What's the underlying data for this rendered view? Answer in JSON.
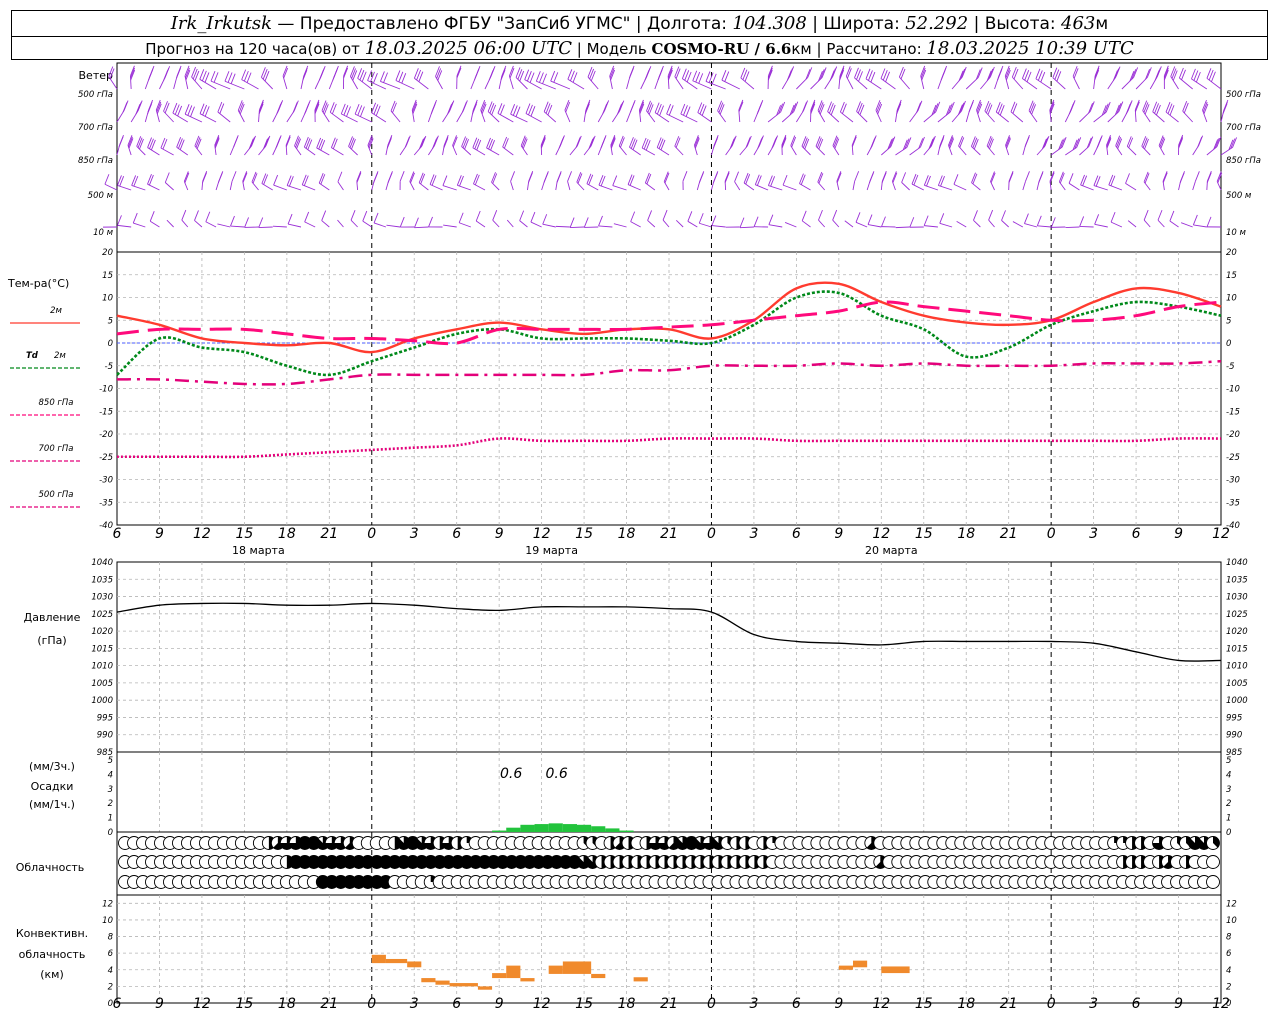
{
  "header": {
    "station": "Irk_Irkutsk",
    "provider": " — Предоставлено ФГБУ \"ЗапСиб УГМС\" | Долгота: ",
    "lon": "104.308",
    "lat_label": " | Широта: ",
    "lat": "52.292",
    "alt_label": " | Высота: ",
    "alt": "463",
    "alt_unit": "м",
    "forecast_prefix": "Прогноз на 120 часа(ов) от ",
    "start_time": "18.03.2025 06:00 UTC",
    "model_label": " | Модель ",
    "model": "COSMO-RU / 6.6",
    "model_unit": "км",
    "calc_label": " | Рассчитано: ",
    "calc_time": "18.03.2025 10:39 UTC"
  },
  "colors": {
    "wind": "#9a2fd6",
    "t2m": "#ff3b2f",
    "td2m": "#00891a",
    "t850": "#ff0a7c",
    "t700": "#e3007a",
    "t500": "#e3007a",
    "pressure": "#000000",
    "precip": "#22c33c",
    "convective": "#f08a2c",
    "zero_line": "#4a5bff",
    "grid": "#b5b5b5"
  },
  "wind_panel": {
    "title": "Ветер",
    "levels": [
      "500 гПа",
      "700 гПа",
      "850 гПа",
      "500 м",
      "10 м"
    ],
    "icon": "wind-barb-icon"
  },
  "temp_panel": {
    "title": "Тем-ра(°С)",
    "legend": [
      {
        "id": "t2m",
        "label": "2м"
      },
      {
        "id": "td2m",
        "label_sym": "Td",
        "label": "2м"
      },
      {
        "id": "t850",
        "label": "850 гПа"
      },
      {
        "id": "t700",
        "label": "700 гПа"
      },
      {
        "id": "t500",
        "label": "500 гПа"
      }
    ]
  },
  "pressure_panel": {
    "title1": "Давление",
    "title2": "(гПа)"
  },
  "precip_panel": {
    "unit1": "(мм/3ч.)",
    "title": "Осадки",
    "unit2": "(мм/1ч.)",
    "labels": [
      "0.6",
      "0.6"
    ]
  },
  "cloud_panel": {
    "title": "Облачность",
    "icon": "cloud-cover-circle-icon"
  },
  "conv_panel": {
    "title1": "Конвективн.",
    "title2": "облачность",
    "title3": "(км)"
  },
  "x_axis": {
    "ticks": [
      "6",
      "9",
      "12",
      "15",
      "18",
      "21",
      "0",
      "3",
      "6",
      "9",
      "12",
      "15",
      "18",
      "21",
      "0",
      "3",
      "6",
      "9",
      "12",
      "15",
      "18",
      "21",
      "0",
      "3",
      "6",
      "9",
      "12"
    ],
    "days": [
      "18 марта",
      "19 марта",
      "20 марта"
    ]
  },
  "chart_data": {
    "type": "line",
    "x_hours": [
      0,
      3,
      6,
      9,
      12,
      15,
      18,
      21,
      24,
      27,
      30,
      33,
      36,
      39,
      42,
      45,
      48,
      51,
      54,
      57,
      60,
      63,
      66,
      69,
      72,
      75,
      78
    ],
    "temperature": {
      "ylim": [
        -40,
        20
      ],
      "yticks": [
        "20",
        "15",
        "10",
        "5",
        "0",
        "-5",
        "-10",
        "-15",
        "-20",
        "-25",
        "-30",
        "-35",
        "-40"
      ],
      "series": [
        {
          "id": "t2m",
          "style": "solid",
          "values": [
            6,
            4,
            1,
            0,
            -0.5,
            0,
            -2,
            1,
            3,
            4.5,
            3,
            2,
            3,
            3,
            1,
            5,
            12,
            13,
            9,
            6,
            4.5,
            4,
            5,
            9,
            12,
            11,
            8
          ]
        },
        {
          "id": "td2m",
          "style": "dotted",
          "values": [
            -7,
            1,
            -1,
            -2,
            -5,
            -7,
            -4,
            -1,
            2,
            3,
            1,
            1,
            1,
            0.5,
            0,
            4,
            10,
            11,
            6,
            3,
            -3,
            -1,
            4,
            7,
            9,
            8,
            6
          ]
        },
        {
          "id": "t850",
          "style": "longdash",
          "values": [
            2,
            3,
            3,
            3,
            2,
            1,
            1,
            0.5,
            0,
            3,
            3,
            3,
            3,
            3.5,
            4,
            5,
            6,
            7,
            9,
            8,
            7,
            6,
            5,
            5,
            6,
            8,
            9
          ]
        },
        {
          "id": "t700",
          "style": "dashdot",
          "values": [
            -8,
            -8,
            -8.5,
            -9,
            -9,
            -8,
            -7,
            -7,
            -7,
            -7,
            -7,
            -7,
            -6,
            -6,
            -5,
            -5,
            -5,
            -4.5,
            -5,
            -4.5,
            -5,
            -5,
            -5,
            -4.5,
            -4.5,
            -4.5,
            -4
          ]
        },
        {
          "id": "t500",
          "style": "dotted",
          "values": [
            -25,
            -25,
            -25,
            -25,
            -24.5,
            -24,
            -23.5,
            -23,
            -22.5,
            -21,
            -21.5,
            -21.5,
            -21.5,
            -21,
            -21,
            -21,
            -21.5,
            -21.5,
            -21.5,
            -21.5,
            -21.5,
            -21.5,
            -21.5,
            -21.5,
            -21.5,
            -21,
            -21
          ]
        }
      ]
    },
    "pressure": {
      "ylim": [
        985,
        1040
      ],
      "yticks": [
        "1040",
        "1035",
        "1030",
        "1025",
        "1020",
        "1015",
        "1010",
        "1005",
        "1000",
        "995",
        "990",
        "985"
      ],
      "values": [
        1025.5,
        1027.5,
        1028,
        1028,
        1027.5,
        1027.5,
        1028,
        1027.5,
        1026.5,
        1026,
        1027,
        1027,
        1027,
        1026.5,
        1025.5,
        1019,
        1017,
        1016.5,
        1016,
        1017,
        1017,
        1017,
        1017,
        1016.5,
        1014,
        1011.5,
        1011.5
      ]
    },
    "precipitation": {
      "ylim": [
        0,
        5
      ],
      "yticks": [
        "5",
        "4",
        "3",
        "2",
        "1",
        "0"
      ],
      "x_hours": [
        27,
        28,
        29,
        30,
        31,
        32,
        33,
        34,
        35,
        36
      ],
      "values": [
        0.1,
        0.3,
        0.5,
        0.55,
        0.6,
        0.55,
        0.5,
        0.4,
        0.25,
        0.1
      ]
    },
    "cloud_rows": [
      [
        "0",
        "0",
        "0",
        "0",
        "0",
        "0",
        "0",
        "0",
        "0",
        "0",
        "0",
        "0",
        "0",
        "0",
        "0",
        "0",
        "4",
        "5",
        "6",
        "6",
        "8",
        "8",
        "7",
        "6",
        "6",
        "5",
        "0",
        "0",
        "0",
        "0",
        "4",
        "7",
        "8",
        "7",
        "6",
        "4",
        "6",
        "4",
        "2",
        "0",
        "0",
        "0",
        "0",
        "0",
        "0",
        "0",
        "0",
        "0",
        "0",
        "0",
        "0",
        "3",
        "3",
        "0",
        "4",
        "5",
        "4",
        "0",
        "4",
        "6",
        "6",
        "5",
        "7",
        "8",
        "7",
        "6",
        "7",
        "3",
        "4",
        "4",
        "0",
        "4",
        "2",
        "0",
        "0",
        "0",
        "0",
        "0",
        "0",
        "0",
        "0",
        "0",
        "0",
        "5",
        "0",
        "0",
        "0",
        "0",
        "0",
        "0",
        "0",
        "0",
        "0",
        "0",
        "0",
        "0",
        "0",
        "0",
        "0",
        "0",
        "0",
        "0",
        "0",
        "0",
        "0",
        "0",
        "0",
        "0",
        "0",
        "0",
        "2",
        "2",
        "4",
        "4",
        "0",
        "6",
        "0",
        "3",
        "3",
        "7",
        "7",
        "3"
      ],
      [
        "0",
        "0",
        "0",
        "0",
        "0",
        "0",
        "0",
        "0",
        "0",
        "0",
        "0",
        "0",
        "0",
        "0",
        "0",
        "0",
        "0",
        "0",
        "4",
        "8",
        "8",
        "8",
        "8",
        "8",
        "8",
        "8",
        "8",
        "8",
        "8",
        "8",
        "8",
        "8",
        "8",
        "8",
        "8",
        "8",
        "8",
        "8",
        "8",
        "8",
        "8",
        "8",
        "8",
        "8",
        "8",
        "8",
        "8",
        "8",
        "8",
        "8",
        "8",
        "7",
        "7",
        "4",
        "4",
        "4",
        "4",
        "4",
        "4",
        "4",
        "4",
        "4",
        "4",
        "4",
        "4",
        "4",
        "4",
        "4",
        "4",
        "4",
        "4",
        "4",
        "0",
        "0",
        "0",
        "0",
        "0",
        "0",
        "0",
        "0",
        "0",
        "0",
        "0",
        "0",
        "5",
        "0",
        "0",
        "0",
        "0",
        "0",
        "0",
        "0",
        "0",
        "0",
        "0",
        "0",
        "0",
        "0",
        "0",
        "0",
        "0",
        "0",
        "0",
        "0",
        "0",
        "0",
        "0",
        "0",
        "0",
        "0",
        "0",
        "4",
        "4",
        "4",
        "0",
        "4",
        "5",
        "0",
        "4",
        "0",
        "0",
        "0"
      ],
      [
        "0",
        "0",
        "0",
        "0",
        "0",
        "0",
        "0",
        "0",
        "0",
        "0",
        "0",
        "0",
        "0",
        "0",
        "0",
        "0",
        "0",
        "0",
        "0",
        "0",
        "0",
        "0",
        "8",
        "8",
        "8",
        "8",
        "8",
        "8",
        "8",
        "8",
        "0",
        "0",
        "0",
        "0",
        "2",
        "0",
        "0",
        "0",
        "0",
        "0",
        "0",
        "0",
        "0",
        "0",
        "0",
        "0",
        "0",
        "0",
        "0",
        "0",
        "0",
        "0",
        "0",
        "0",
        "0",
        "0",
        "0",
        "0",
        "0",
        "0",
        "0",
        "0",
        "0",
        "0",
        "0",
        "0",
        "0",
        "0",
        "0",
        "0",
        "0",
        "0",
        "0",
        "0",
        "0",
        "0",
        "0",
        "0",
        "0",
        "0",
        "0",
        "0",
        "0",
        "0",
        "0",
        "0",
        "0",
        "0",
        "0",
        "0",
        "0",
        "0",
        "0",
        "0",
        "0",
        "0",
        "0",
        "0",
        "0",
        "0",
        "0",
        "0",
        "0",
        "0",
        "0",
        "0",
        "0",
        "0",
        "0",
        "0",
        "0",
        "0",
        "0",
        "0",
        "0",
        "0",
        "0",
        "0",
        "0",
        "0",
        "0",
        "0"
      ]
    ],
    "convective": {
      "ylim": [
        0,
        13
      ],
      "yticks": [
        "12",
        "10",
        "8",
        "6",
        "4",
        "2",
        "0"
      ],
      "blocks": [
        {
          "x": [
            18,
            19
          ],
          "y": [
            4.8,
            5.8
          ]
        },
        {
          "x": [
            19,
            20.5
          ],
          "y": [
            4.8,
            5.3
          ]
        },
        {
          "x": [
            20.5,
            21.5
          ],
          "y": [
            4.3,
            5.0
          ]
        },
        {
          "x": [
            21.5,
            22.5
          ],
          "y": [
            2.5,
            3.0
          ]
        },
        {
          "x": [
            22.5,
            23.5
          ],
          "y": [
            2.2,
            2.7
          ]
        },
        {
          "x": [
            23.5,
            25.5
          ],
          "y": [
            2.0,
            2.4
          ]
        },
        {
          "x": [
            25.5,
            26.5
          ],
          "y": [
            1.6,
            2.0
          ]
        },
        {
          "x": [
            26.5,
            27.5
          ],
          "y": [
            3.0,
            3.6
          ]
        },
        {
          "x": [
            27.5,
            28.5
          ],
          "y": [
            3.0,
            4.5
          ]
        },
        {
          "x": [
            28.5,
            29.5
          ],
          "y": [
            2.6,
            3.0
          ]
        },
        {
          "x": [
            30.5,
            31.5
          ],
          "y": [
            3.5,
            4.5
          ]
        },
        {
          "x": [
            31.5,
            33.5
          ],
          "y": [
            3.5,
            5.0
          ]
        },
        {
          "x": [
            33.5,
            34.5
          ],
          "y": [
            3.0,
            3.5
          ]
        },
        {
          "x": [
            36.5,
            37.5
          ],
          "y": [
            2.6,
            3.1
          ]
        },
        {
          "x": [
            51,
            52
          ],
          "y": [
            4.0,
            4.5
          ]
        },
        {
          "x": [
            52,
            53
          ],
          "y": [
            4.3,
            5.1
          ]
        },
        {
          "x": [
            54,
            56
          ],
          "y": [
            3.6,
            4.4
          ]
        }
      ]
    }
  }
}
